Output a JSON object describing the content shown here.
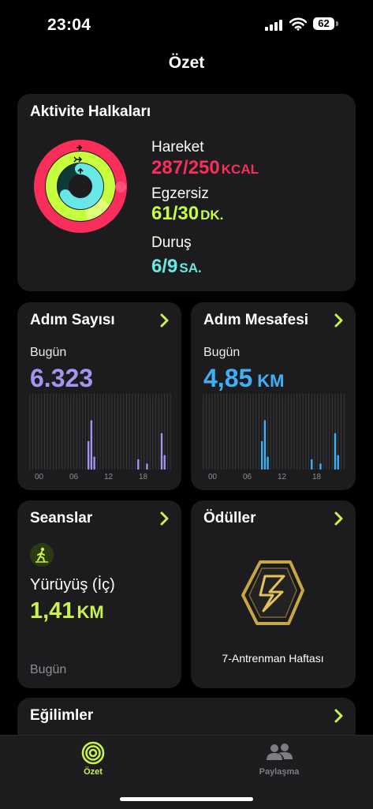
{
  "status_bar": {
    "time": "23:04",
    "battery": "62"
  },
  "header": {
    "title": "Özet"
  },
  "activity": {
    "title": "Aktivite Halkaları",
    "move": {
      "label": "Hareket",
      "value": "287/250",
      "unit": "KCAL",
      "progress": 1.148,
      "color": "#fa2e5a"
    },
    "exercise": {
      "label": "Egzersiz",
      "value": "61/30",
      "unit": "DK.",
      "progress": 2.03,
      "color": "#c6ff3d"
    },
    "stand": {
      "label": "Duruş",
      "value": "6/9",
      "unit": "SA.",
      "progress": 0.667,
      "color": "#67e8e6"
    }
  },
  "steps": {
    "title": "Adım Sayısı",
    "sub": "Bugün",
    "value": "6.323",
    "color": "#a794f0",
    "x_labels": [
      "00",
      "06",
      "12",
      "18"
    ],
    "hourly": [
      0,
      0,
      0,
      0,
      0,
      0,
      0,
      0,
      0,
      0,
      0,
      0,
      0,
      0,
      0,
      0,
      0,
      0,
      0,
      0,
      0.55,
      0.95,
      0.25,
      0,
      0,
      0,
      0,
      0,
      0,
      0,
      0,
      0,
      0,
      0,
      0,
      0,
      0,
      0.2,
      0,
      0,
      0.12,
      0,
      0,
      0,
      0,
      0.7,
      0.28,
      0,
      0
    ]
  },
  "distance": {
    "title": "Adım Mesafesi",
    "sub": "Bugün",
    "value": "4,85",
    "unit": "KM",
    "color": "#40b0f6",
    "x_labels": [
      "00",
      "06",
      "12",
      "18"
    ],
    "hourly": [
      0,
      0,
      0,
      0,
      0,
      0,
      0,
      0,
      0,
      0,
      0,
      0,
      0,
      0,
      0,
      0,
      0,
      0,
      0,
      0,
      0.55,
      0.95,
      0.25,
      0,
      0,
      0,
      0,
      0,
      0,
      0,
      0,
      0,
      0,
      0,
      0,
      0,
      0,
      0.2,
      0,
      0,
      0.12,
      0,
      0,
      0,
      0,
      0.7,
      0.28,
      0,
      0
    ]
  },
  "workouts": {
    "title": "Seanslar",
    "name": "Yürüyüş (İç)",
    "value": "1,41",
    "unit": "KM",
    "date": "Bugün",
    "icon": "walking-figure-icon"
  },
  "awards": {
    "title": "Ödüller",
    "label": "7-Antrenman Haftası",
    "icon": "award-badge-icon"
  },
  "trends": {
    "title": "Eğilimler"
  },
  "tabs": [
    {
      "label": "Özet",
      "active": true,
      "color": "#c9f24a"
    },
    {
      "label": "Paylaşma",
      "active": false,
      "color": "#7d7d82"
    }
  ],
  "accent": "#c9f24a"
}
